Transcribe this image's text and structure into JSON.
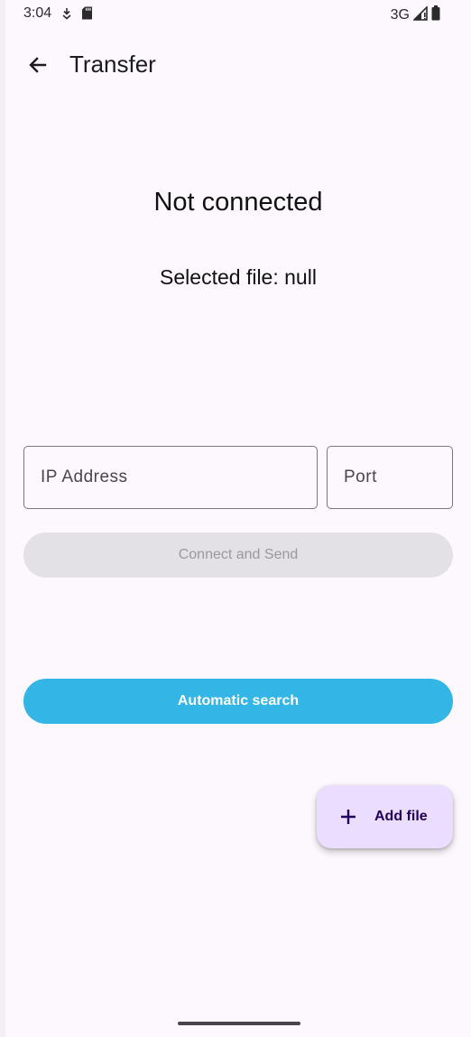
{
  "status_bar": {
    "time": "3:04",
    "network": "3G",
    "icons": [
      "download-icon",
      "sd-card-icon",
      "signal-icon",
      "battery-icon"
    ]
  },
  "app_bar": {
    "title": "Transfer",
    "back_icon": "arrow-back-icon"
  },
  "main": {
    "status_message": "Not connected",
    "selected_file": "Selected file: null",
    "ip_field": {
      "placeholder": "IP Address",
      "value": ""
    },
    "port_field": {
      "placeholder": "Port",
      "value": ""
    },
    "connect_button_label": "Connect and Send",
    "search_button_label": "Automatic search"
  },
  "fab": {
    "label": "Add file",
    "icon": "plus-icon"
  },
  "colors": {
    "background": "#fdf8fd",
    "accent": "#33b5e5",
    "fab_background": "#eaddff",
    "disabled_button": "#e3e1e5"
  }
}
